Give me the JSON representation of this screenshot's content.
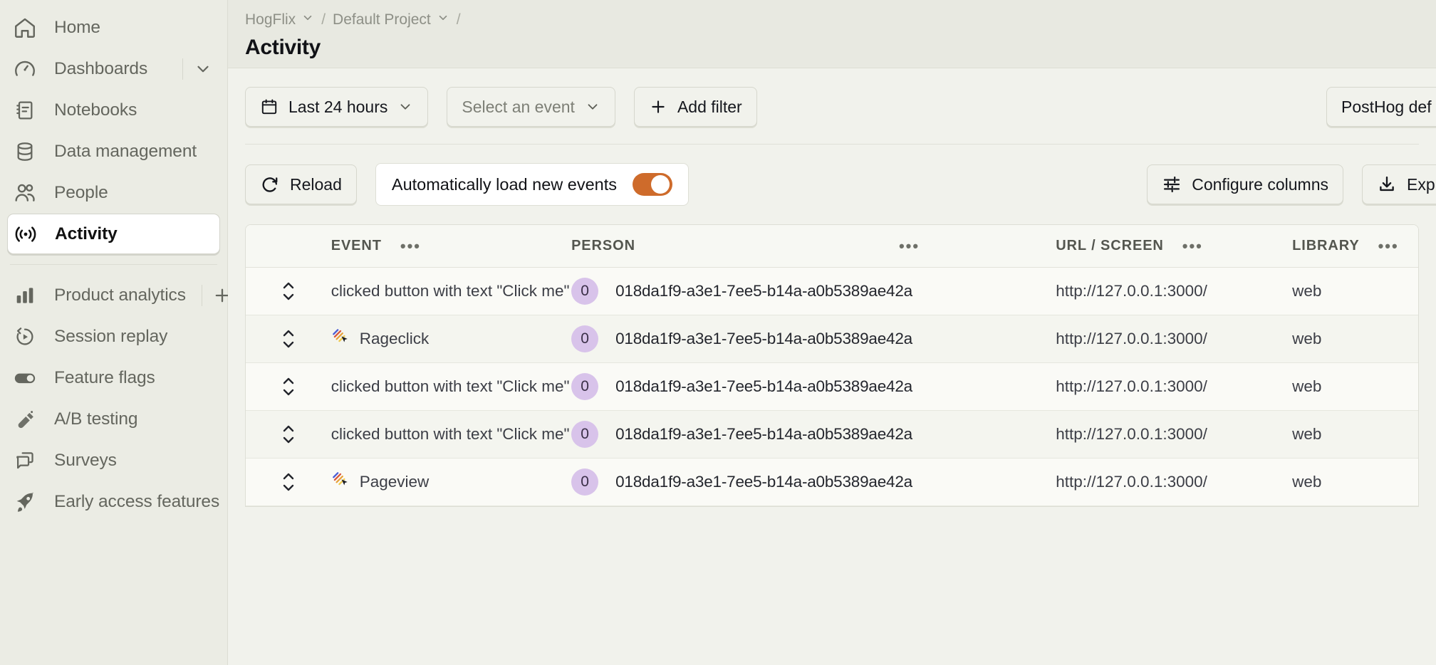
{
  "sidebar": {
    "items": [
      {
        "label": "Home",
        "icon": "home-icon",
        "active": false
      },
      {
        "label": "Dashboards",
        "icon": "gauge-icon",
        "active": false,
        "has_expand": true
      },
      {
        "label": "Notebooks",
        "icon": "notebook-icon",
        "active": false
      },
      {
        "label": "Data management",
        "icon": "database-icon",
        "active": false
      },
      {
        "label": "People",
        "icon": "people-icon",
        "active": false
      },
      {
        "label": "Activity",
        "icon": "broadcast-icon",
        "active": true
      }
    ],
    "items2": [
      {
        "label": "Product analytics",
        "icon": "bar-chart-icon",
        "active": false,
        "has_add": true
      },
      {
        "label": "Session replay",
        "icon": "replay-icon",
        "active": false
      },
      {
        "label": "Feature flags",
        "icon": "toggle-icon",
        "active": false
      },
      {
        "label": "A/B testing",
        "icon": "flask-icon",
        "active": false
      },
      {
        "label": "Surveys",
        "icon": "chat-icon",
        "active": false
      },
      {
        "label": "Early access features",
        "icon": "rocket-icon",
        "active": false
      }
    ]
  },
  "header": {
    "breadcrumbs": [
      {
        "label": "HogFlix",
        "has_chevron": true
      },
      {
        "label": "Default Project",
        "has_chevron": true
      }
    ],
    "separator": "/",
    "title": "Activity"
  },
  "filters": {
    "date_range": "Last 24 hours",
    "event_select_placeholder": "Select an event",
    "add_filter": "Add filter",
    "right_control": "PostHog def"
  },
  "toolbar": {
    "reload": "Reload",
    "auto_load_label": "Automatically load new events",
    "auto_load_enabled": true,
    "configure_columns": "Configure columns",
    "export": "Exp"
  },
  "table": {
    "columns": [
      {
        "key": "sort",
        "label": ""
      },
      {
        "key": "event",
        "label": "EVENT",
        "has_menu": true
      },
      {
        "key": "person",
        "label": "PERSON",
        "has_menu": true
      },
      {
        "key": "url",
        "label": "URL / SCREEN",
        "has_menu": true
      },
      {
        "key": "library",
        "label": "LIBRARY",
        "has_menu": true
      }
    ],
    "menu_glyph": "•••",
    "rows": [
      {
        "event": "clicked button with text \"Click me\"",
        "event_icon": null,
        "person_initial": "0",
        "person": "018da1f9-a3e1-7ee5-b14a-a0b5389ae42a",
        "url": "http://127.0.0.1:3000/",
        "library": "web"
      },
      {
        "event": "Rageclick",
        "event_icon": "rageclick-icon",
        "person_initial": "0",
        "person": "018da1f9-a3e1-7ee5-b14a-a0b5389ae42a",
        "url": "http://127.0.0.1:3000/",
        "library": "web"
      },
      {
        "event": "clicked button with text \"Click me\"",
        "event_icon": null,
        "person_initial": "0",
        "person": "018da1f9-a3e1-7ee5-b14a-a0b5389ae42a",
        "url": "http://127.0.0.1:3000/",
        "library": "web"
      },
      {
        "event": "clicked button with text \"Click me\"",
        "event_icon": null,
        "person_initial": "0",
        "person": "018da1f9-a3e1-7ee5-b14a-a0b5389ae42a",
        "url": "http://127.0.0.1:3000/",
        "library": "web"
      },
      {
        "event": "Pageview",
        "event_icon": "pageview-icon",
        "person_initial": "0",
        "person": "018da1f9-a3e1-7ee5-b14a-a0b5389ae42a",
        "url": "http://127.0.0.1:3000/",
        "library": "web"
      }
    ]
  },
  "colors": {
    "accent": "#CE6B2B",
    "sidebar_bg": "#EBECE4",
    "main_bg": "#F1F2EC",
    "avatar_bg": "#D8C3EA"
  }
}
